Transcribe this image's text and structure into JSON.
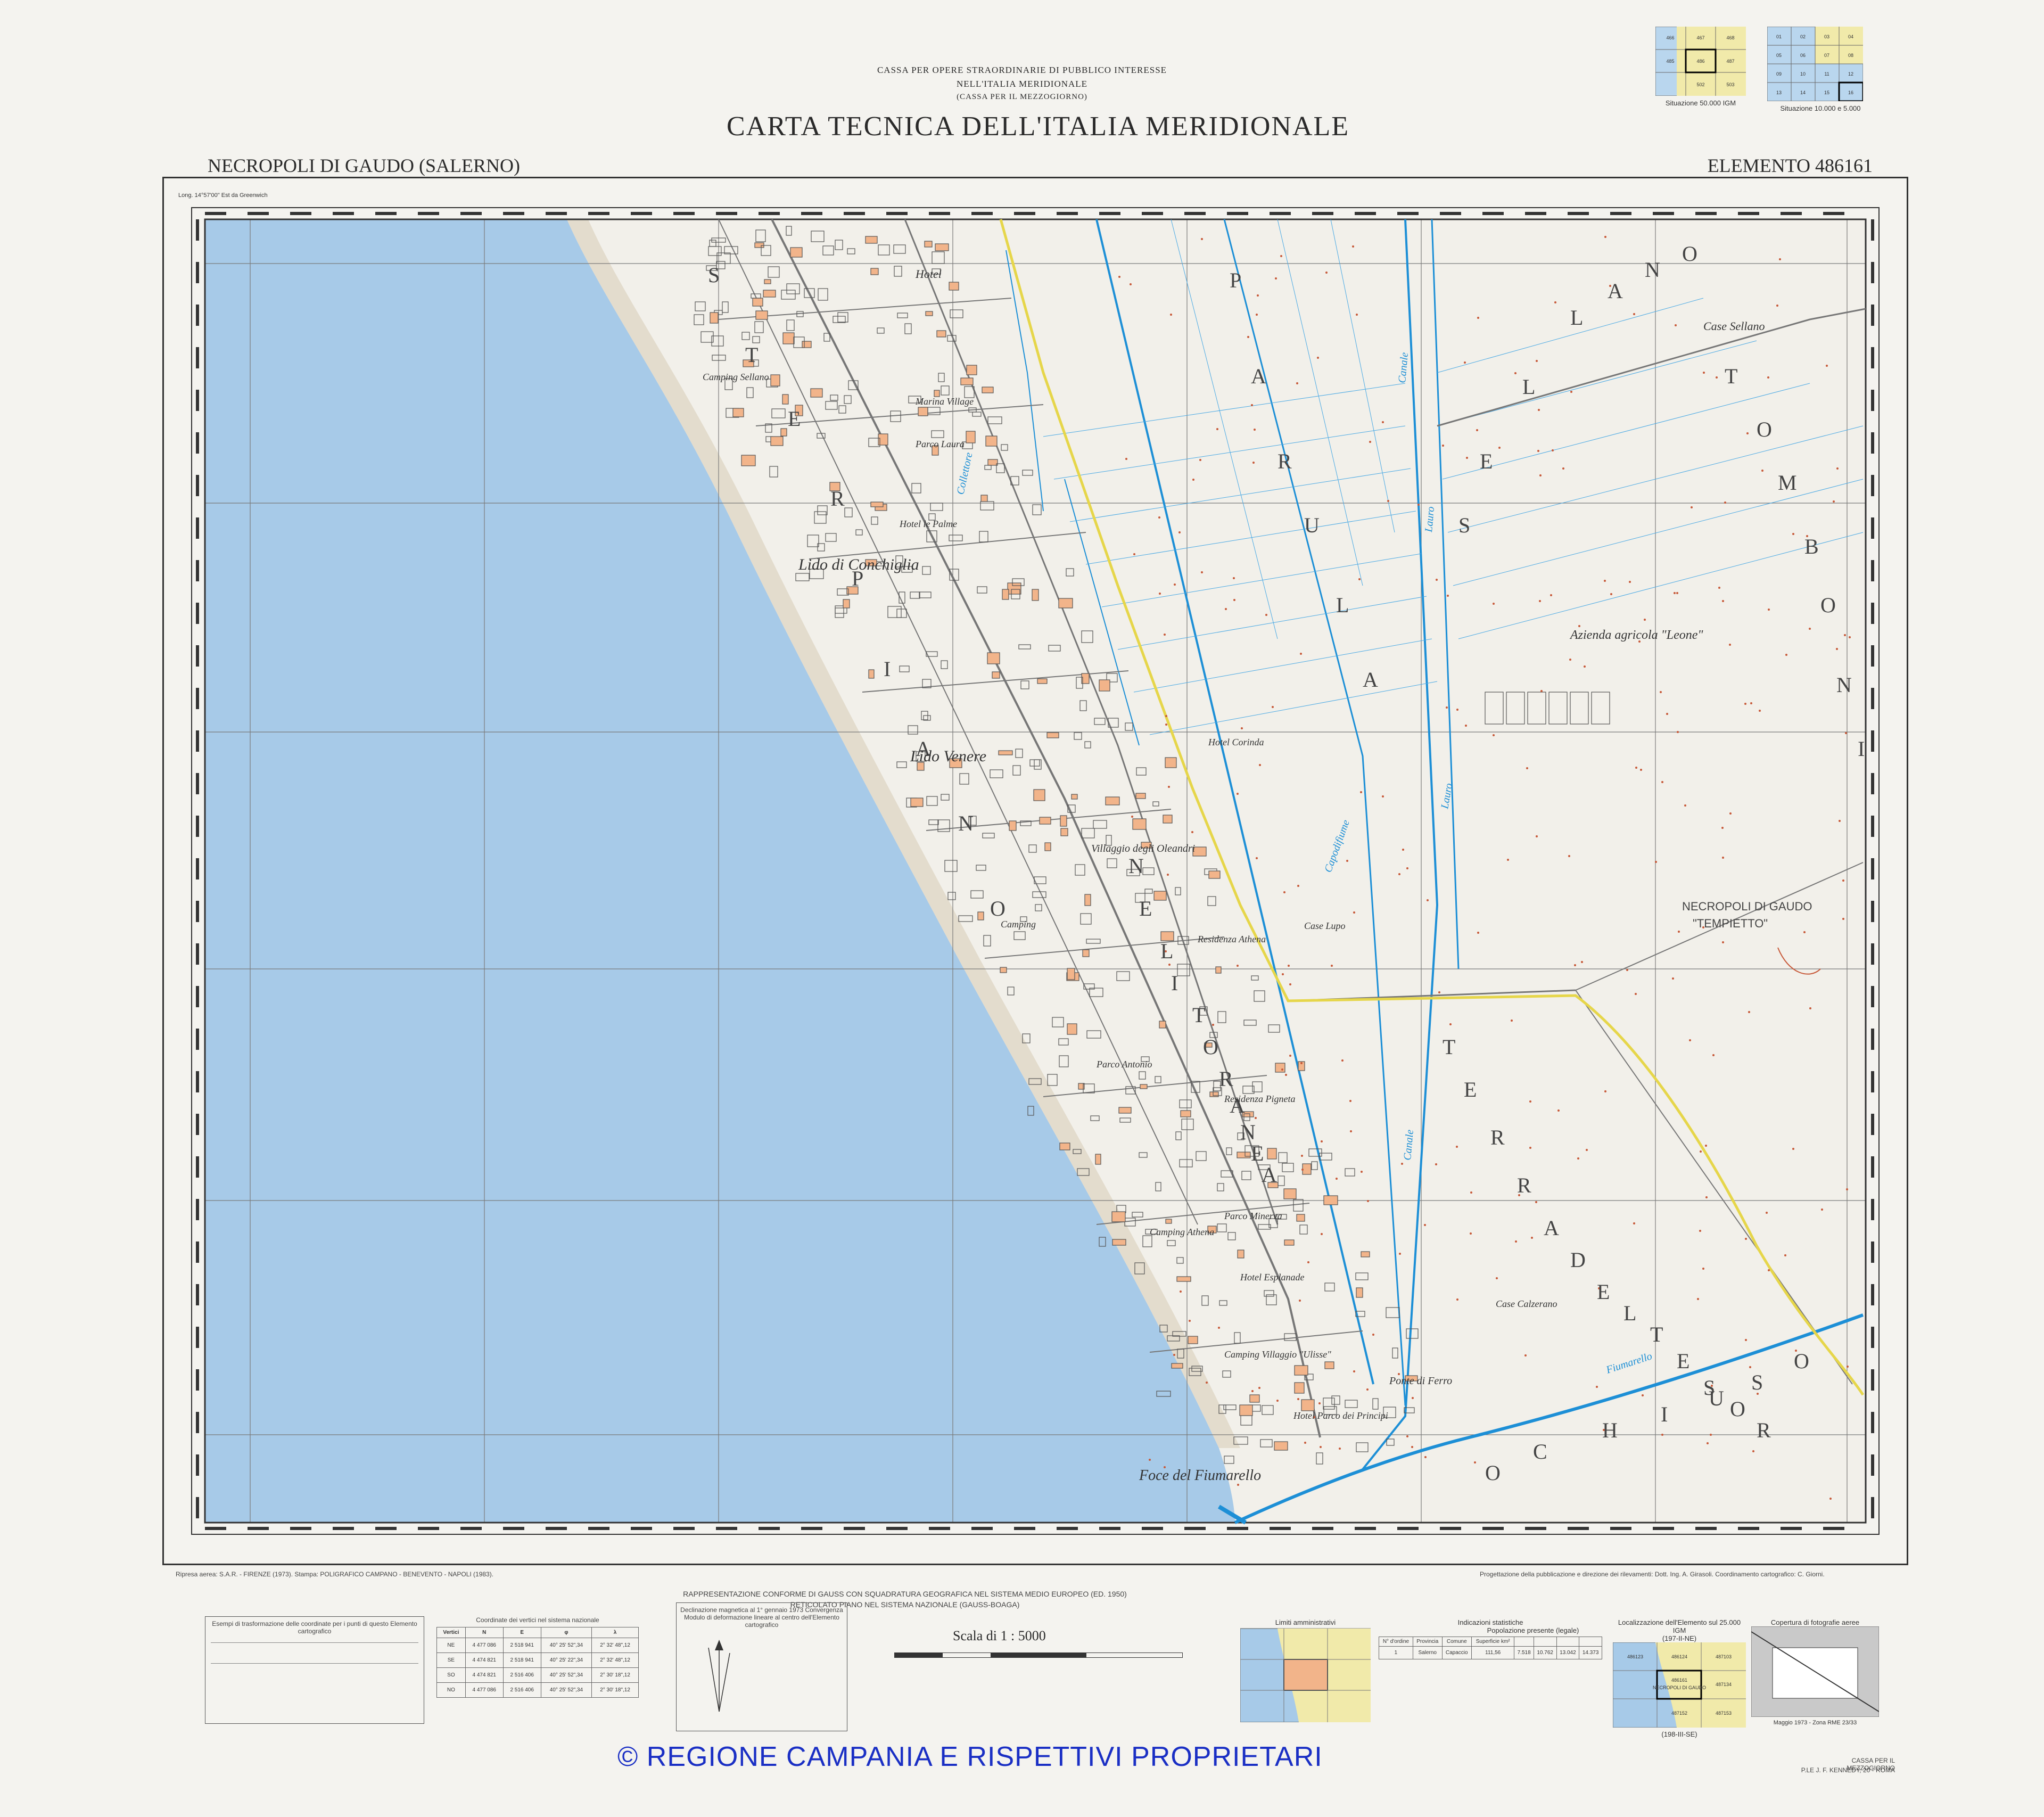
{
  "header": {
    "line1": "CASSA PER OPERE STRAORDINARIE DI PUBBLICO INTERESSE",
    "line2": "NELL'ITALIA MERIDIONALE",
    "line3": "(CASSA PER IL MEZZOGIORNO)",
    "title": "CARTA TECNICA DELL'ITALIA MERIDIONALE",
    "sheet_name": "NECROPOLI DI GAUDO (SALERNO)",
    "element": "ELEMENTO 486161"
  },
  "index_maps": {
    "igm_caption": "Situazione 50.000 IGM",
    "ctr_caption": "Situazione 10.000 e 5.000",
    "igm_cells": [
      "466",
      "467",
      "468",
      "485",
      "486",
      "487",
      "502",
      "503"
    ],
    "ctr_cells": [
      "01",
      "02",
      "03",
      "04",
      "05",
      "06",
      "07",
      "08",
      "09",
      "10",
      "11",
      "12",
      "13",
      "14",
      "15",
      "16"
    ]
  },
  "map": {
    "coord_topleft": "Long. 14°57'00\" Est da Greenwich",
    "place_labels": [
      "Hotel",
      "Camping Sellano",
      "Marina Village",
      "Parco Laura",
      "Hotel le Palme",
      "Lido di Conchiglia",
      "Lido Venere",
      "Villaggio degli Oleandri",
      "Hotel Corinda",
      "Camping",
      "Residenza Athena",
      "Case Lupo",
      "Parco Antonio",
      "Residenza Pigneta",
      "Parco Minerva",
      "Camping Athena",
      "Hotel Esplanade",
      "Camping Villaggio \"Ulisse\"",
      "Ponte di Ferro",
      "Hotel Parco dei Principi",
      "Foce del Fiumarello",
      "Case Sellano",
      "Azienda agricola \"Leone\"",
      "NECROPOLI DI GAUDO",
      "\"TEMPIETTO\"",
      "Case Calzerano"
    ],
    "big_letters": [
      "S",
      "T",
      "E",
      "R",
      "P",
      "I",
      "A",
      "N",
      "O",
      "P",
      "A",
      "R",
      "U",
      "L",
      "A",
      "S",
      "E",
      "L",
      "L",
      "A",
      "N",
      "O",
      "T",
      "O",
      "M",
      "B",
      "O",
      "N",
      "I",
      "T",
      "E",
      "R",
      "R",
      "A",
      "D",
      "E",
      "L",
      "T",
      "E",
      "S",
      "O",
      "R",
      "O",
      "C",
      "H",
      "I",
      "U",
      "S",
      "O",
      "N",
      "E",
      "L",
      "I",
      "T",
      "O",
      "R",
      "A",
      "N",
      "E",
      "A"
    ],
    "canal_labels": [
      "Collettore",
      "Canale",
      "Lauro",
      "Capodifiume",
      "Fiumarello",
      "Canale",
      "Lauro"
    ]
  },
  "footer": {
    "tables_title": "RAPPRESENTAZIONE CONFORME DI GAUSS CON SQUADRATURA GEOGRAFICA NEL SISTEMA MEDIO EUROPEO (ED. 1950)",
    "tables_subtitle": "RETICOLATO PIANO NEL SISTEMA NAZIONALE (GAUSS-BOAGA)",
    "example_title": "Esempi di trasformazione delle coordinate per i punti di questo Elemento cartografico",
    "vertex_title": "Coordinate dei vertici nel sistema nazionale",
    "vertex_headers": [
      "Vertici",
      "N",
      "E",
      "φ",
      "λ"
    ],
    "vertex_rows": [
      [
        "NE",
        "4 477 086",
        "2 518 941",
        "40° 25' 52\",34",
        "2° 32' 48\",12"
      ],
      [
        "SE",
        "4 474 821",
        "2 518 941",
        "40° 25' 22\",34",
        "2° 32' 48\",12"
      ],
      [
        "SO",
        "4 474 821",
        "2 516 406",
        "40° 25' 52\",34",
        "2° 30' 18\",12"
      ],
      [
        "NO",
        "4 477 086",
        "2 516 406",
        "40° 25' 52\",34",
        "2° 30' 18\",12"
      ]
    ],
    "magnetic_title": "Declinazione magnetica al 1° gennaio 1973 Convergenza Modulo di deformazione lineare al centro dell'Elemento cartografico",
    "scale": "Scala di 1 : 5000",
    "admin_title": "Limiti amministrativi",
    "stats_title": "Indicazioni statistiche",
    "stats_headers": [
      "N° d'ordine",
      "Provincia",
      "Comune",
      "Superficie km²"
    ],
    "stats_row": [
      "1",
      "Salerno",
      "Capaccio",
      "111,56",
      "7.518",
      "10.762",
      "13.042",
      "14.373"
    ],
    "population_title": "Popolazione presente (legale)",
    "locator_title": "Localizzazione dell'Elemento sul 25.000 IGM",
    "locator_top": "(197-II-NE)",
    "locator_bottom": "(198-III-SE)",
    "coverage_title": "Copertura di fotografie aeree",
    "coverage_note": "Maggio 1973 - Zona RME 23/33",
    "locator_cells": [
      "486123",
      "486124",
      "487103",
      "486161",
      "487134",
      "486162",
      "487152",
      "487153"
    ],
    "locator_center": "NECROPOLI DI GAUDO",
    "publisher": "CASSA PER IL MEZZOGIORNO",
    "publisher_addr": "P.LE J. F. KENNEDY, 20 - ROMA",
    "copyright": "© REGIONE CAMPANIA E RISPETTIVI PROPRIETARI",
    "credits_left": "Ripresa aerea: S.A.R. - FIRENZE (1973). Stampa: POLIGRAFICO CAMPANO - BENEVENTO - NAPOLI (1983).",
    "credits_right": "Progettazione della pubblicazione e direzione dei rilevamenti: Dott. Ing. A. Girasoli. Coordinamento cartografico: C. Giorni."
  },
  "colors": {
    "sea": "#a7cae8",
    "land": "#f2f0ea",
    "canal": "#1d8fd6",
    "road_yellow": "#e6d64a",
    "grid": "#7a7a7a",
    "copyright": "#1a2fc4"
  }
}
